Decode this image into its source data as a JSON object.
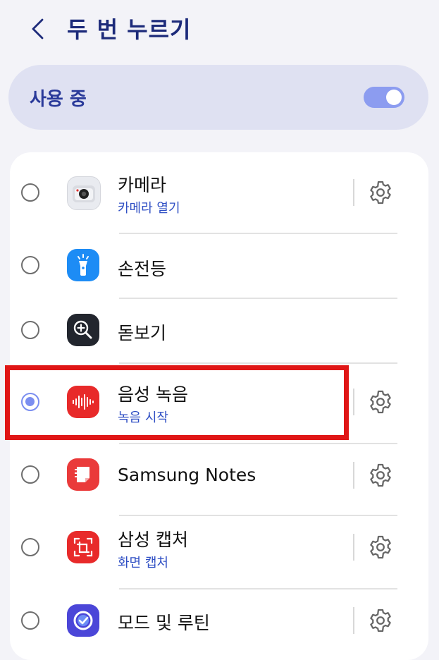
{
  "header": {
    "title": "두 번 누르기",
    "back_icon": "chevron-left-icon"
  },
  "master_toggle": {
    "label": "사용 중",
    "state": "on",
    "accent": "#8c9cf0"
  },
  "colors": {
    "accent": "#7b8ef0",
    "sublabel": "#2f4fc4",
    "highlight": "#e01616"
  },
  "actions": [
    {
      "name": "카메라",
      "sub": "카메라 열기",
      "icon": "camera-icon",
      "selected": false,
      "settings": true
    },
    {
      "name": "손전등",
      "sub": "",
      "icon": "flashlight-icon",
      "selected": false,
      "settings": false
    },
    {
      "name": "돋보기",
      "sub": "",
      "icon": "magnifier-icon",
      "selected": false,
      "settings": false
    },
    {
      "name": "음성 녹음",
      "sub": "녹음 시작",
      "icon": "voice-recorder-icon",
      "selected": true,
      "settings": true
    },
    {
      "name": "Samsung Notes",
      "sub": "",
      "icon": "samsung-notes-icon",
      "selected": false,
      "settings": true
    },
    {
      "name": "삼성 캡처",
      "sub": "화면 캡처",
      "icon": "screen-capture-icon",
      "selected": false,
      "settings": true
    },
    {
      "name": "모드 및 루틴",
      "sub": "",
      "icon": "modes-routines-icon",
      "selected": false,
      "settings": true
    }
  ]
}
